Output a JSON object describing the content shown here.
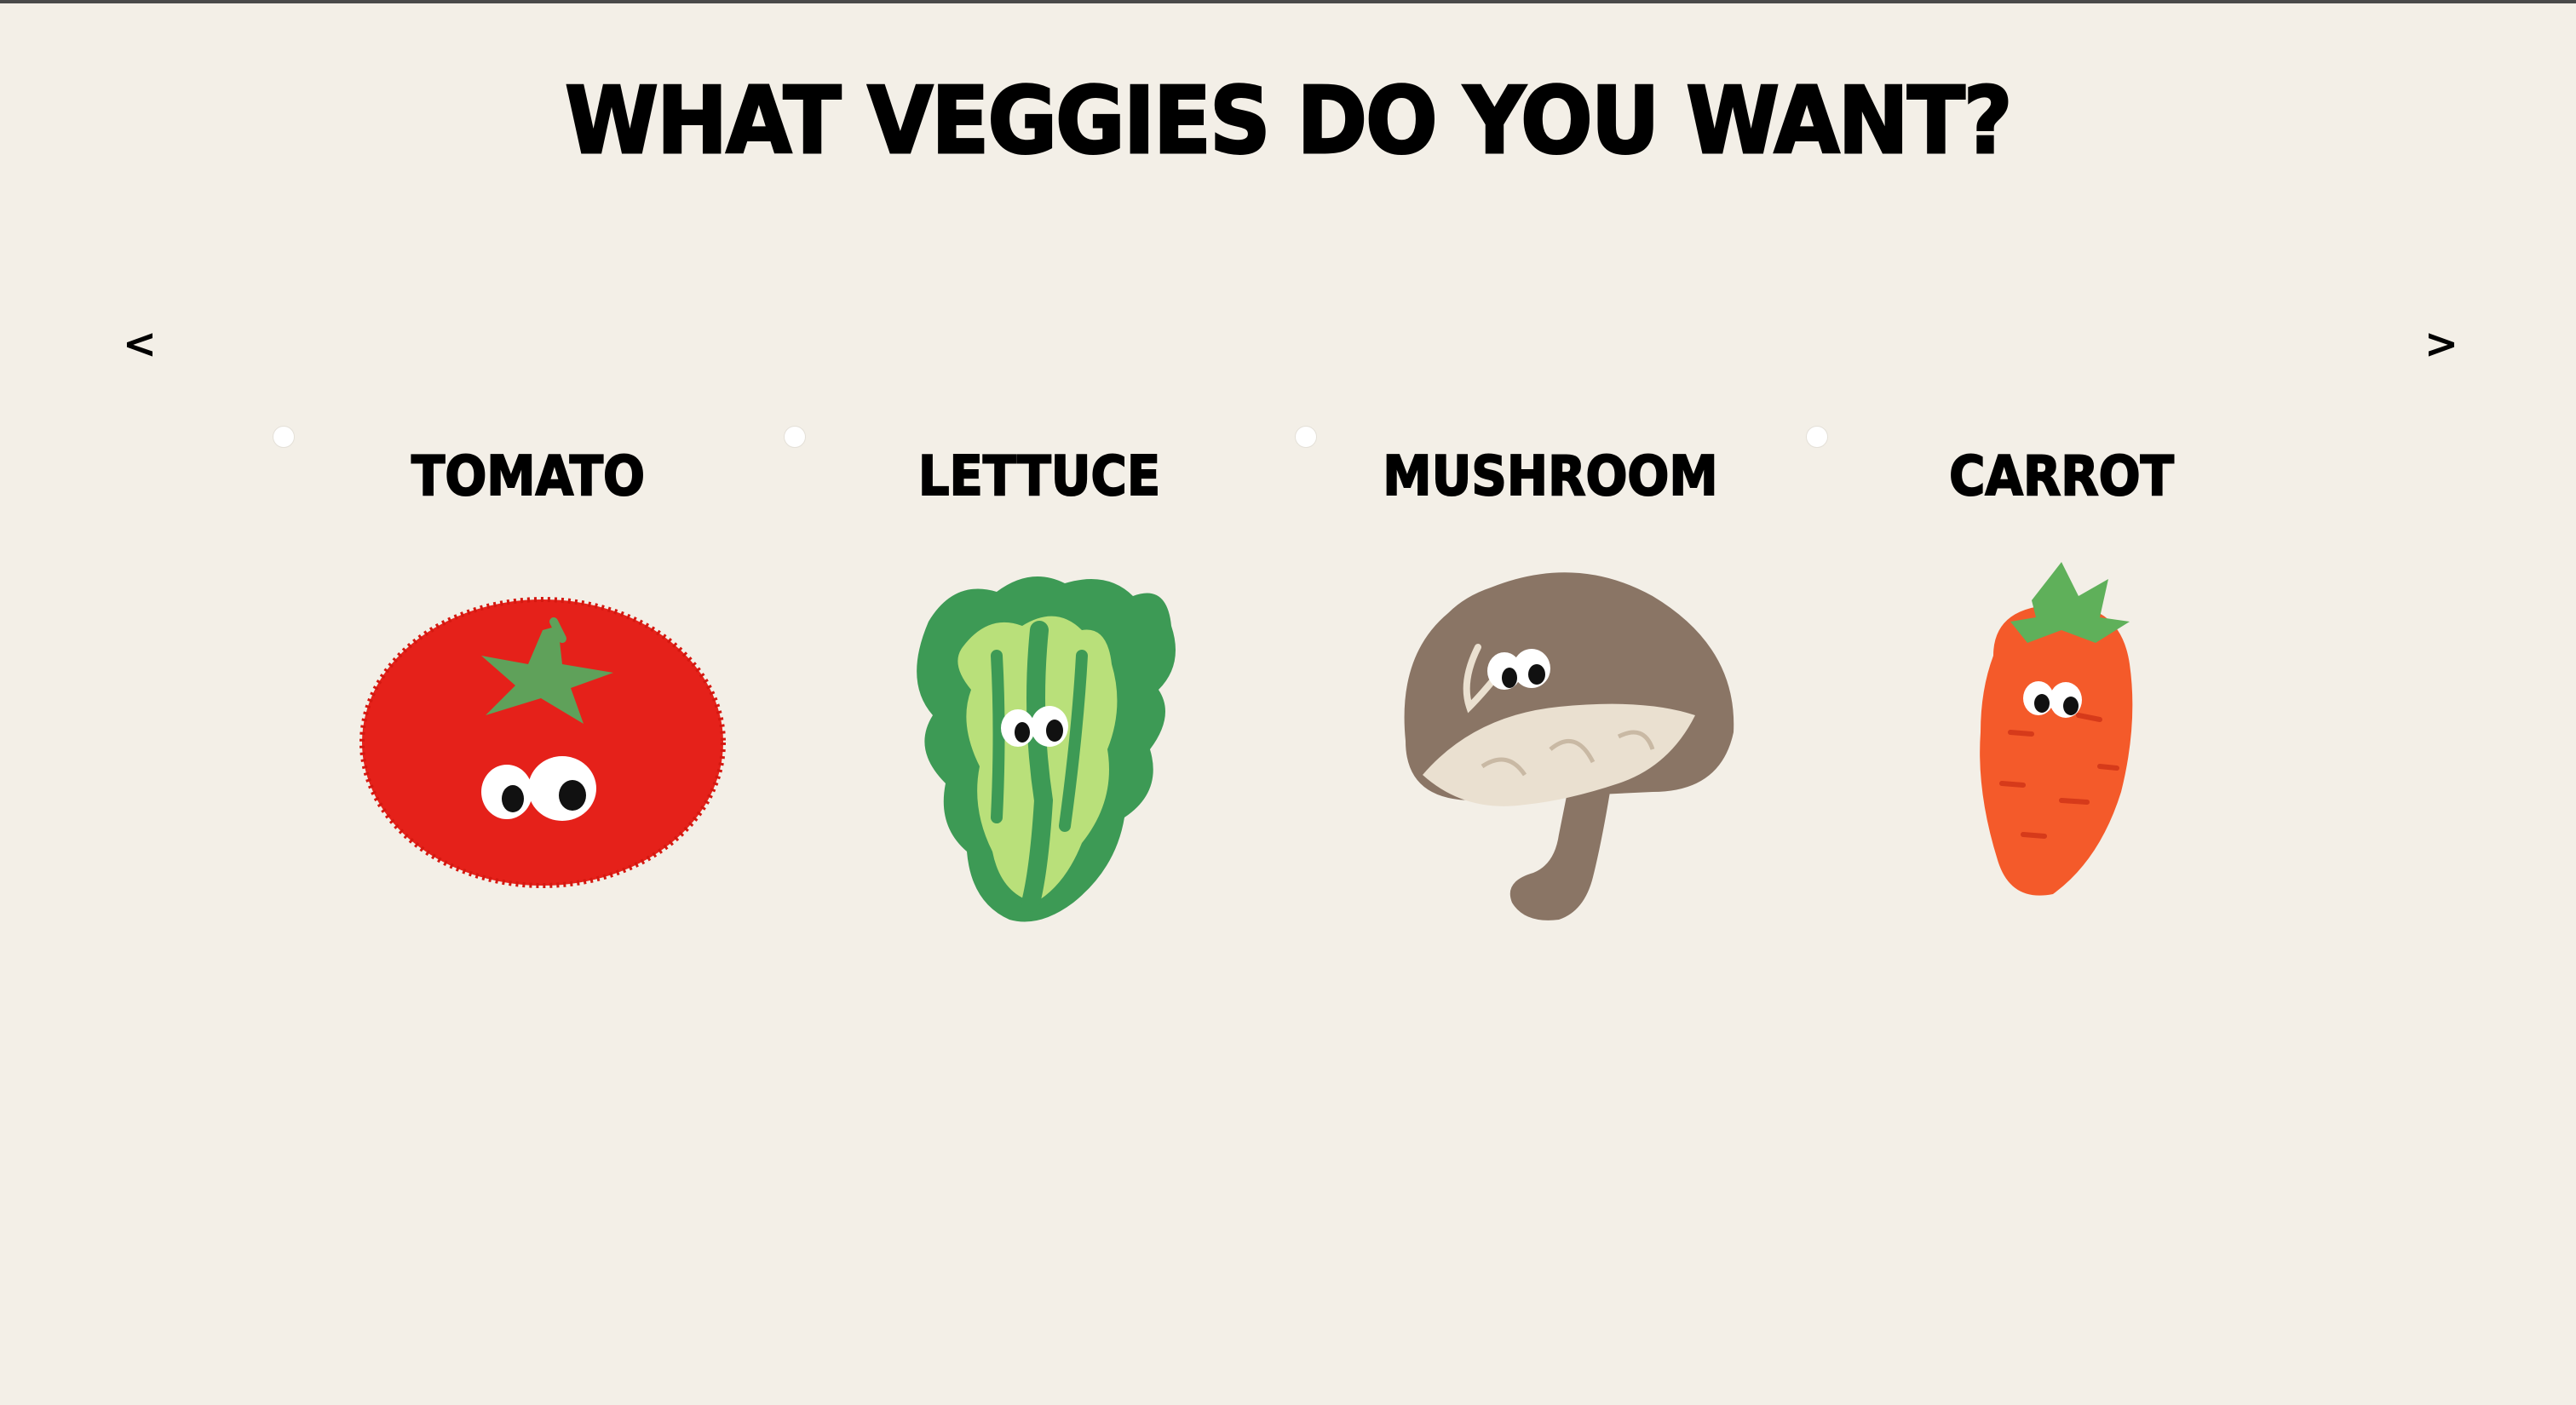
{
  "page": {
    "title": "WHAT VEGGIES DO YOU WANT?"
  },
  "nav": {
    "prev_label": "<",
    "next_label": ">"
  },
  "veggies": [
    {
      "label": "TOMATO",
      "icon": "tomato-icon",
      "selected": false
    },
    {
      "label": "LETTUCE",
      "icon": "lettuce-icon",
      "selected": false
    },
    {
      "label": "MUSHROOM",
      "icon": "mushroom-icon",
      "selected": false
    },
    {
      "label": "CARROT",
      "icon": "carrot-icon",
      "selected": false
    }
  ],
  "colors": {
    "background": "#f3efe7",
    "tomato": "#e5211a",
    "lettuce_light": "#b9e07a",
    "lettuce_dark": "#3d9a55",
    "mushroom_cap": "#8a7565",
    "mushroom_gill": "#eae0d0",
    "carrot": "#f45a2a",
    "leaf": "#5fb05a"
  }
}
